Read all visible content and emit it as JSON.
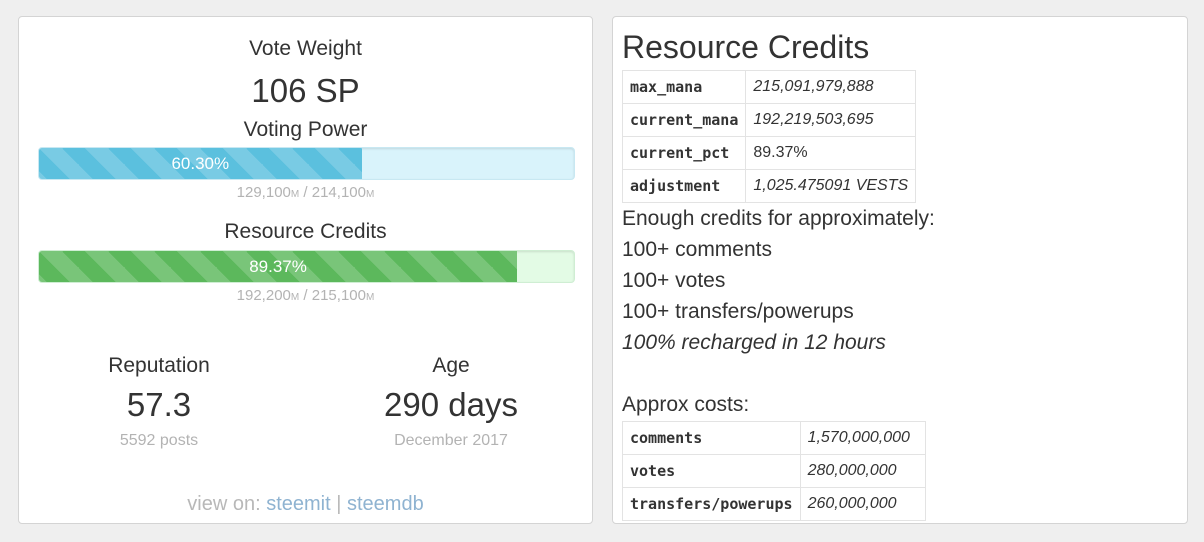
{
  "left": {
    "vote_weight_title": "Vote Weight",
    "vote_weight_value": "106 SP",
    "voting_power": {
      "title": "Voting Power",
      "label": "60.30%",
      "fraction": 0.603,
      "used": "129,100",
      "total": "214,100",
      "unit": "M",
      "separator": " / "
    },
    "resource_credits": {
      "title": "Resource Credits",
      "label": "89.37%",
      "fraction": 0.8937,
      "used": "192,200",
      "total": "215,100",
      "unit": "M",
      "separator": " / "
    },
    "reputation": {
      "title": "Reputation",
      "value": "57.3",
      "sub": "5592 posts"
    },
    "age": {
      "title": "Age",
      "value": "290 days",
      "sub": "December 2017"
    },
    "view_on": {
      "prefix": "view on: ",
      "link1": "steemit",
      "sep": " | ",
      "link2": "steemdb"
    }
  },
  "right": {
    "title": "Resource Credits",
    "mana_rows": [
      {
        "key": "max_mana",
        "value": "215,091,979,888"
      },
      {
        "key": "current_mana",
        "value": "192,219,503,695"
      },
      {
        "key": "current_pct",
        "value": "89.37%"
      },
      {
        "key": "adjustment",
        "value": "1,025.475091 VESTS"
      }
    ],
    "enough_line": "Enough credits for approximately:",
    "comments_line": "100+ comments",
    "votes_line": "100+ votes",
    "transfers_line": "100+ transfers/powerups",
    "recharge_line": "100% recharged in 12 hours",
    "approx_costs": "Approx costs:",
    "cost_rows": [
      {
        "key": "comments",
        "value": "1,570,000,000"
      },
      {
        "key": "votes",
        "value": "280,000,000"
      },
      {
        "key": "transfers/powerups",
        "value": "260,000,000"
      }
    ]
  },
  "colors": {
    "voting_power_bar": "#5bc0de",
    "resource_credits_bar": "#5cb85c",
    "link": "#8fb3d1"
  }
}
